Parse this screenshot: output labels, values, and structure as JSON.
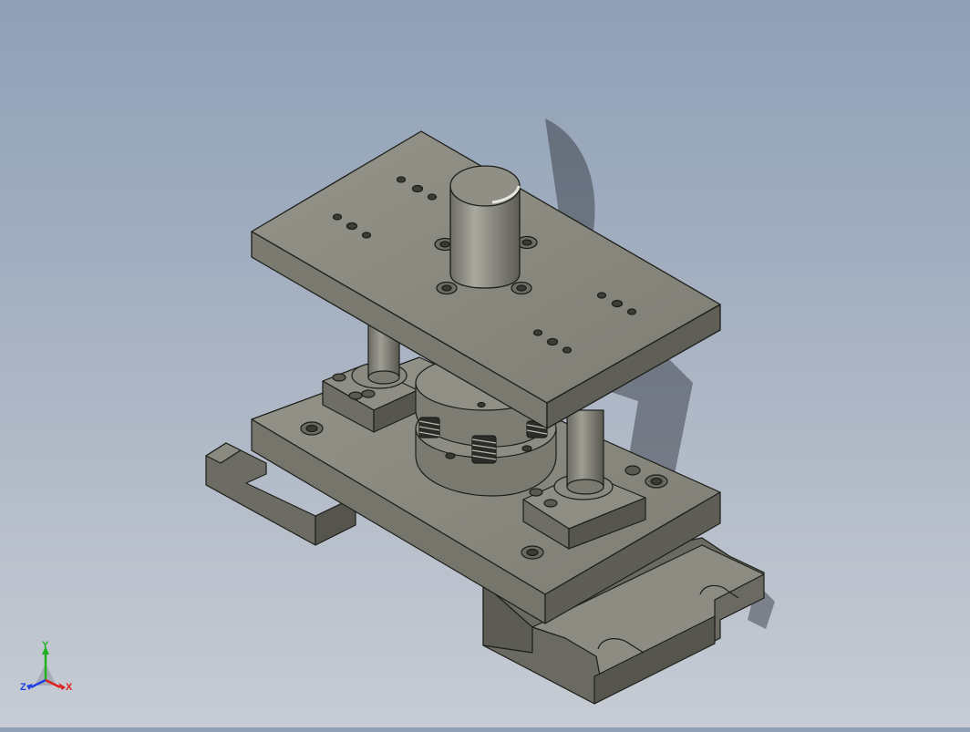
{
  "colors": {
    "part_light": "#8e8e84",
    "part_mid": "#73736a",
    "part_dark": "#4f4f48",
    "edge": "#1e1e1a",
    "x_axis": "#e02020",
    "y_axis": "#20b020",
    "z_axis": "#2040e0"
  },
  "model": {
    "description_icon": "stamping-die-set-icon"
  },
  "triad": {
    "x_label": "X",
    "y_label": "Y",
    "z_label": "Z"
  }
}
